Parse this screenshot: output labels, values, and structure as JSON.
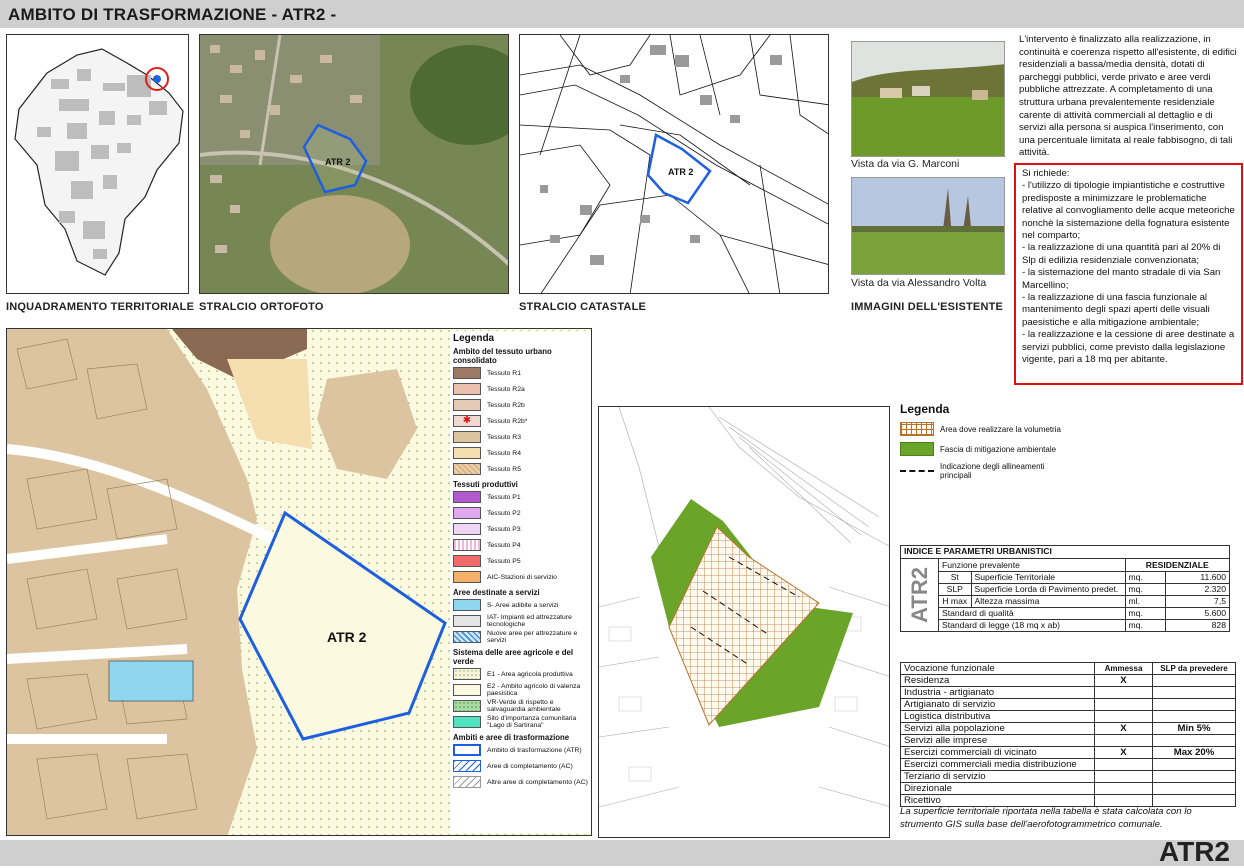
{
  "header": {
    "title": "AMBITO DI TRASFORMAZIONE - ATR2 -"
  },
  "footer": {
    "code": "ATR2"
  },
  "captions": {
    "territorial": "INQUADRAMENTO TERRITORIALE",
    "orthophoto": "STRALCIO ORTOFOTO",
    "cadastral": "STRALCIO CATASTALE",
    "images": "IMMAGINI DELL'ESISTENTE"
  },
  "map_labels": {
    "ortho": "ATR 2",
    "cadastral": "ATR 2",
    "plan": "ATR 2"
  },
  "photos": {
    "photo1_caption": "Vista da via G. Marconi",
    "photo2_caption": "Vista da via Alessandro Volta"
  },
  "description": "L'intervento è finalizzato alla realizzazione, in continuità e coerenza rispetto all'esistente, di edifici residenziali a bassa/media densità, dotati di parcheggi pubblici, verde privato e aree verdi pubbliche attrezzate. A completamento di una struttura urbana prevalentemente residenziale carente di attività commerciali al dettaglio e di servizi alla persona si auspica l'inserimento, con una percentuale limitata al reale fabbisogno, di tali attività.",
  "requirements": {
    "intro": "Si richiede:",
    "items": [
      "- l'utilizzo di tipologie impiantistiche e costruttive predisposte a minimizzare le problematiche relative al convogliamento delle acque meteoriche nonchè la sistemazione della fognatura esistente nel comparto;",
      "- la realizzazione di una quantità pari al 20% di Slp di edilizia residenziale convenzionata;",
      "- la sistemazione del manto stradale di via San Marcellino;",
      "- la realizzazione di una fascia funzionale al mantenimento degli spazi aperti delle visuali paesistiche e alla mitigazione ambientale;",
      "- la realizzazione e la cessione di aree destinate a servizi pubblici, come previsto dalla legislazione vigente, pari a 18 mq per abitante."
    ]
  },
  "legend1": {
    "title": "Legenda",
    "sec1": "Ambito del tessuto urbano consolidato",
    "items1": [
      "Tessuto R1",
      "Tessuto R2a",
      "Tessuto R2b",
      "Tessuto R2b*",
      "Tessuto R3",
      "Tessuto R4",
      "Tessuto R5"
    ],
    "sec2": "Tessuti produttivi",
    "items2": [
      "Tessuto P1",
      "Tessuto P2",
      "Tessuto P3",
      "Tessuto P4",
      "Tessuto P5",
      "AIC-Stazioni di servizio"
    ],
    "sec3": "Aree destinate a servizi",
    "items3": [
      "S- Aree adibite a servizi",
      "IAT- Impianti ed attrezzature tecnologiche",
      "Nuove aree per attrezzature e servizi"
    ],
    "sec4": "Sistema delle aree agricole e del verde",
    "items4": [
      "E1 - Area agricola produttiva",
      "E2 - Ambito agricolo di valenza paesistica",
      "VR-Verde di rispetto e salvaguardia ambientale",
      "Sito d'importanza comunitaria \"Lago di Sartirana\""
    ],
    "sec5": "Ambiti e aree di trasformazione",
    "items5": [
      "Ambito di trasformazione (ATR)",
      "Aree di completamento (AC)",
      "Altre aree di completamento (AC)"
    ]
  },
  "legend2": {
    "title": "Legenda",
    "items": [
      "Area dove realizzare la volumetria",
      "Fascia di mitigazione ambientale",
      "Indicazione degli allineamenti principali"
    ]
  },
  "params": {
    "title": "INDICE E PARAMETRI URBANISTICI",
    "vertical": "ATR2",
    "head_label": "Funzione prevalente",
    "head_value": "RESIDENZIALE",
    "rows": [
      {
        "abbr": "St",
        "label": "Superficie Territoriale",
        "unit": "mq.",
        "value": "11.600"
      },
      {
        "abbr": "SLP",
        "label": "Superficie Lorda di Pavimento predet.",
        "unit": "mq.",
        "value": "2.320"
      },
      {
        "abbr": "H max",
        "label": "Altezza massima",
        "unit": "ml.",
        "value": "7,5"
      }
    ],
    "rows2": [
      {
        "label": "Standard di qualità",
        "unit": "mq.",
        "value": "5.600"
      },
      {
        "label": "Standard di legge (18 mq x ab)",
        "unit": "mq.",
        "value": "828"
      }
    ]
  },
  "vocazione": {
    "head": [
      "Vocazione funzionale",
      "Ammessa",
      "SLP da prevedere"
    ],
    "rows": [
      [
        "Residenza",
        "X",
        ""
      ],
      [
        "Industria - artigianato",
        "",
        ""
      ],
      [
        "Artigianato di servizio",
        "",
        ""
      ],
      [
        "Logistica distributiva",
        "",
        ""
      ],
      [
        "Servizi alla popolazione",
        "X",
        "Min 5%"
      ],
      [
        "Servizi alle imprese",
        "",
        ""
      ],
      [
        "Esercizi commerciali di vicinato",
        "X",
        "Max 20%"
      ],
      [
        "Esercizi commerciali media distribuzione",
        "",
        ""
      ],
      [
        "Terziario di servizio",
        "",
        ""
      ],
      [
        "Direzionale",
        "",
        ""
      ],
      [
        "Ricettivo",
        "",
        ""
      ]
    ]
  },
  "note": "La superficie territoriale riportata nella tabella è stata calcolata con lo strumento GIS sulla base dell'aerofotogrammetrico comunale."
}
